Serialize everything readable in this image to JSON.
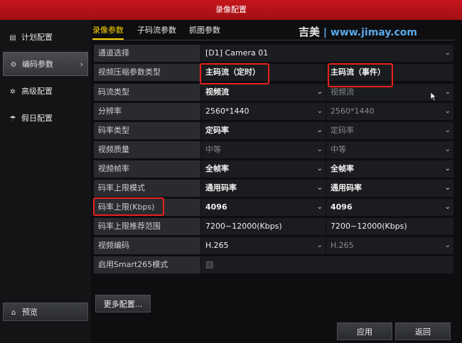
{
  "window": {
    "title": "录像配置"
  },
  "sidebar": {
    "items": [
      {
        "label": "计划配置",
        "icon": "calendar-icon"
      },
      {
        "label": "编码参数",
        "icon": "gear-icon",
        "active": true
      },
      {
        "label": "高级配置",
        "icon": "advanced-gear-icon"
      },
      {
        "label": "假日配置",
        "icon": "umbrella-icon"
      }
    ],
    "preview_label": "预览"
  },
  "tabs": [
    {
      "label": "录像参数",
      "active": true
    },
    {
      "label": "子码流参数"
    },
    {
      "label": "抓图参数"
    }
  ],
  "watermark": {
    "cn": "吉美",
    "url": "www.jimay.com"
  },
  "form": {
    "rows": [
      {
        "label": "通道选择",
        "value": "[D1] Camera 01"
      },
      {
        "label": "视频压缩参数类型",
        "a": "主码流（定时）",
        "b": "主码流（事件）"
      },
      {
        "label": "码流类型",
        "a": "视频流",
        "b": "视频流"
      },
      {
        "label": "分辨率",
        "a": "2560*1440",
        "b": "2560*1440"
      },
      {
        "label": "码率类型",
        "a": "定码率",
        "b": "定码率"
      },
      {
        "label": "视频质量",
        "a": "中等",
        "b": "中等"
      },
      {
        "label": "视频帧率",
        "a": "全帧率",
        "b": "全帧率"
      },
      {
        "label": "码率上限模式",
        "a": "通用码率",
        "b": "通用码率"
      },
      {
        "label": "码率上限(Kbps)",
        "a": "4096",
        "b": "4096"
      },
      {
        "label": "码率上限推荐范围",
        "a": "7200~12000(Kbps)",
        "b": "7200~12000(Kbps)"
      },
      {
        "label": "视频编码",
        "a": "H.265",
        "b": "H.265"
      },
      {
        "label": "启用Smart265模式"
      }
    ]
  },
  "buttons": {
    "more": "更多配置...",
    "apply": "应用",
    "back": "返回"
  },
  "colors": {
    "title_bar": "#b3121a",
    "active_tab": "#ffd400",
    "highlight": "#e8201c",
    "watermark": "#5aa8e8"
  }
}
